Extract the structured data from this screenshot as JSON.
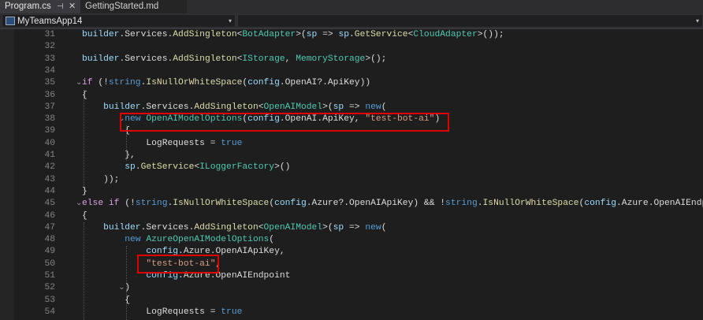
{
  "tabs": [
    {
      "label": "Program.cs",
      "active": true,
      "pin": "⊣",
      "close": "✕"
    },
    {
      "label": "GettingStarted.md",
      "active": false
    }
  ],
  "navbar": {
    "project": "MyTeamsApp14",
    "caret": "▾"
  },
  "editor": {
    "lines": [
      {
        "n": "31",
        "ind": 0,
        "t": [
          [
            "var",
            "builder"
          ],
          [
            "pl",
            "."
          ],
          [
            "pl",
            "Services"
          ],
          [
            "pl",
            "."
          ],
          [
            "fn",
            "AddSingleton"
          ],
          [
            "pl",
            "<"
          ],
          [
            "ty",
            "BotAdapter"
          ],
          [
            "pl",
            ">("
          ],
          [
            "var",
            "sp"
          ],
          [
            "pl",
            " => "
          ],
          [
            "var",
            "sp"
          ],
          [
            "pl",
            "."
          ],
          [
            "fn",
            "GetService"
          ],
          [
            "pl",
            "<"
          ],
          [
            "ty",
            "CloudAdapter"
          ],
          [
            "pl",
            ">());"
          ]
        ]
      },
      {
        "n": "32",
        "ind": 0,
        "t": []
      },
      {
        "n": "33",
        "ind": 0,
        "t": [
          [
            "var",
            "builder"
          ],
          [
            "pl",
            ".Services."
          ],
          [
            "fn",
            "AddSingleton"
          ],
          [
            "pl",
            "<"
          ],
          [
            "ty",
            "IStorage"
          ],
          [
            "pl",
            ", "
          ],
          [
            "ty",
            "MemoryStorage"
          ],
          [
            "pl",
            ">();"
          ]
        ]
      },
      {
        "n": "34",
        "ind": 0,
        "t": []
      },
      {
        "n": "35",
        "ind": 0,
        "fold": "⌄",
        "t": [
          [
            "ctl",
            "if"
          ],
          [
            "pl",
            " (!"
          ],
          [
            "kw",
            "string"
          ],
          [
            "pl",
            "."
          ],
          [
            "fn",
            "IsNullOrWhiteSpace"
          ],
          [
            "pl",
            "("
          ],
          [
            "var",
            "config"
          ],
          [
            "pl",
            ".OpenAI?.ApiKey))"
          ]
        ]
      },
      {
        "n": "36",
        "ind": 0,
        "t": [
          [
            "pl",
            "{"
          ]
        ]
      },
      {
        "n": "37",
        "ind": 4,
        "t": [
          [
            "var",
            "builder"
          ],
          [
            "pl",
            ".Services."
          ],
          [
            "fn",
            "AddSingleton"
          ],
          [
            "pl",
            "<"
          ],
          [
            "ty",
            "OpenAIModel"
          ],
          [
            "pl",
            ">("
          ],
          [
            "var",
            "sp"
          ],
          [
            "pl",
            " => "
          ],
          [
            "kw",
            "new"
          ],
          [
            "pl",
            "("
          ]
        ]
      },
      {
        "n": "38",
        "ind": 8,
        "fold": "⌄",
        "t": [
          [
            "kw",
            "new"
          ],
          [
            "pl",
            " "
          ],
          [
            "ty",
            "OpenAIModelOptions"
          ],
          [
            "pl",
            "("
          ],
          [
            "var",
            "config"
          ],
          [
            "pl",
            ".OpenAI.ApiKey, "
          ],
          [
            "str",
            "\"test-bot-ai\""
          ],
          [
            "pl",
            ")"
          ]
        ]
      },
      {
        "n": "39",
        "ind": 8,
        "t": [
          [
            "pl",
            "{"
          ]
        ]
      },
      {
        "n": "40",
        "ind": 12,
        "t": [
          [
            "pl",
            "LogRequests = "
          ],
          [
            "kw",
            "true"
          ]
        ]
      },
      {
        "n": "41",
        "ind": 8,
        "t": [
          [
            "pl",
            "},"
          ]
        ]
      },
      {
        "n": "42",
        "ind": 8,
        "t": [
          [
            "var",
            "sp"
          ],
          [
            "pl",
            "."
          ],
          [
            "fn",
            "GetService"
          ],
          [
            "pl",
            "<"
          ],
          [
            "ty",
            "ILoggerFactory"
          ],
          [
            "pl",
            ">()"
          ]
        ]
      },
      {
        "n": "43",
        "ind": 4,
        "t": [
          [
            "pl",
            "));"
          ]
        ]
      },
      {
        "n": "44",
        "ind": 0,
        "t": [
          [
            "pl",
            "}"
          ]
        ]
      },
      {
        "n": "45",
        "ind": 0,
        "fold": "⌄",
        "t": [
          [
            "ctl",
            "else if"
          ],
          [
            "pl",
            " (!"
          ],
          [
            "kw",
            "string"
          ],
          [
            "pl",
            "."
          ],
          [
            "fn",
            "IsNullOrWhiteSpace"
          ],
          [
            "pl",
            "("
          ],
          [
            "var",
            "config"
          ],
          [
            "pl",
            ".Azure?.OpenAIApiKey) && !"
          ],
          [
            "kw",
            "string"
          ],
          [
            "pl",
            "."
          ],
          [
            "fn",
            "IsNullOrWhiteSpace"
          ],
          [
            "pl",
            "("
          ],
          [
            "var",
            "config"
          ],
          [
            "pl",
            ".Azure.OpenAIEndpoint"
          ]
        ]
      },
      {
        "n": "46",
        "ind": 0,
        "t": [
          [
            "pl",
            "{"
          ]
        ]
      },
      {
        "n": "47",
        "ind": 4,
        "t": [
          [
            "var",
            "builder"
          ],
          [
            "pl",
            ".Services."
          ],
          [
            "fn",
            "AddSingleton"
          ],
          [
            "pl",
            "<"
          ],
          [
            "ty",
            "OpenAIModel"
          ],
          [
            "pl",
            ">("
          ],
          [
            "var",
            "sp"
          ],
          [
            "pl",
            " => "
          ],
          [
            "kw",
            "new"
          ],
          [
            "pl",
            "("
          ]
        ]
      },
      {
        "n": "48",
        "ind": 8,
        "t": [
          [
            "kw",
            "new"
          ],
          [
            "pl",
            " "
          ],
          [
            "ty",
            "AzureOpenAIModelOptions"
          ],
          [
            "pl",
            "("
          ]
        ]
      },
      {
        "n": "49",
        "ind": 12,
        "t": [
          [
            "var",
            "config"
          ],
          [
            "pl",
            ".Azure.OpenAIApiKey,"
          ]
        ]
      },
      {
        "n": "50",
        "ind": 12,
        "t": [
          [
            "str",
            "\"test-bot-ai\""
          ],
          [
            "pl",
            ","
          ]
        ]
      },
      {
        "n": "51",
        "ind": 12,
        "t": [
          [
            "var",
            "config"
          ],
          [
            "pl",
            ".Azure.OpenAIEndpoint"
          ]
        ]
      },
      {
        "n": "52",
        "ind": 8,
        "fold": "⌄",
        "t": [
          [
            "pl",
            ")"
          ]
        ]
      },
      {
        "n": "53",
        "ind": 8,
        "t": [
          [
            "pl",
            "{"
          ]
        ]
      },
      {
        "n": "54",
        "ind": 12,
        "t": [
          [
            "pl",
            "LogRequests = "
          ],
          [
            "kw",
            "true"
          ]
        ]
      }
    ]
  },
  "highlight_color": "#e00000"
}
